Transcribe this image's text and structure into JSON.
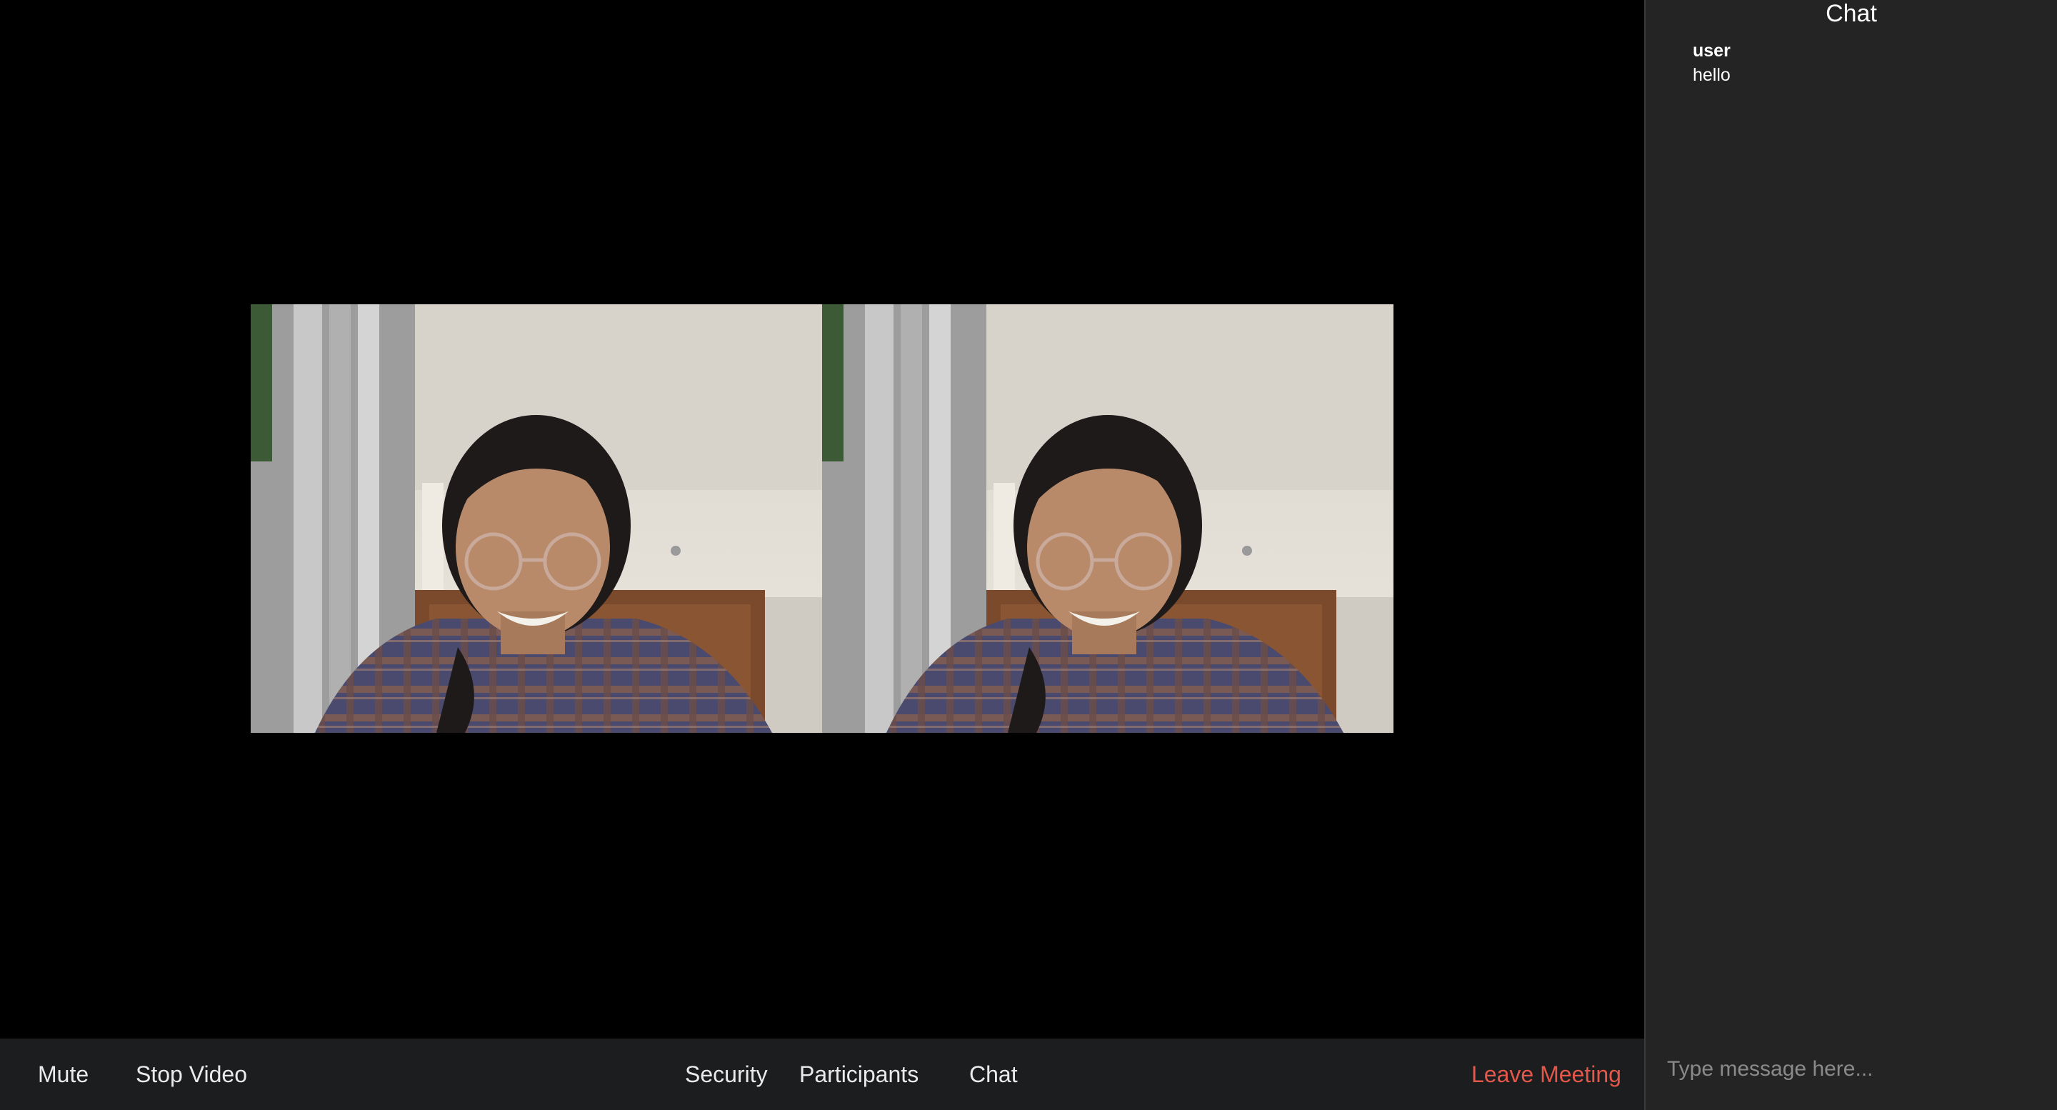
{
  "toolbar": {
    "mute": "Mute",
    "stop_video": "Stop Video",
    "security": "Security",
    "participants": "Participants",
    "chat": "Chat",
    "leave": "Leave Meeting",
    "leave_color": "#e5574a"
  },
  "chat": {
    "title": "Chat",
    "messages": [
      {
        "user": "user",
        "text": "hello"
      }
    ],
    "input_placeholder": "Type message here..."
  },
  "videos": [
    {
      "name": "participant-video"
    },
    {
      "name": "participant-video"
    }
  ]
}
